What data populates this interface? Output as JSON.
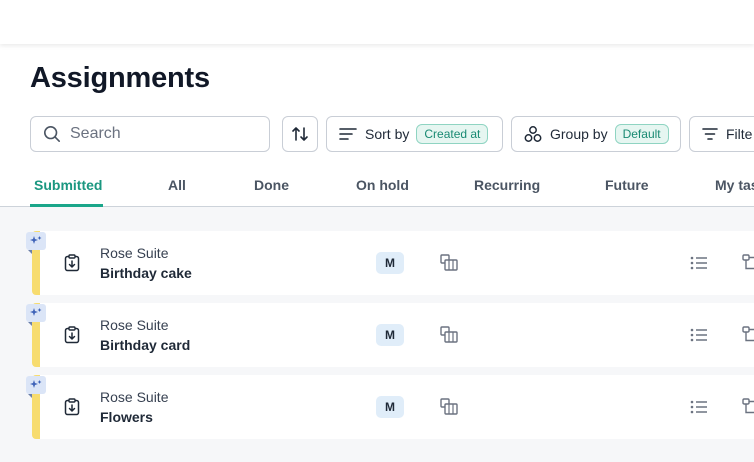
{
  "page": {
    "title": "Assignments"
  },
  "toolbar": {
    "search_placeholder": "Search",
    "sort_label": "Sort by",
    "sort_value": "Created at",
    "group_label": "Group by",
    "group_value": "Default",
    "filter_label": "Filte"
  },
  "tabs": [
    {
      "label": "Submitted",
      "active": true
    },
    {
      "label": "All"
    },
    {
      "label": "Done"
    },
    {
      "label": "On hold"
    },
    {
      "label": "Recurring"
    },
    {
      "label": "Future"
    },
    {
      "label": "My tas"
    }
  ],
  "tasks": [
    {
      "location": "Rose Suite",
      "name": "Birthday cake",
      "size": "M"
    },
    {
      "location": "Rose Suite",
      "name": "Birthday card",
      "size": "M"
    },
    {
      "location": "Rose Suite",
      "name": "Flowers",
      "size": "M"
    }
  ],
  "colors": {
    "accent": "#1aa68a",
    "card_stripe": "#f7dc6f",
    "size_badge_bg": "#e0edf9",
    "spark_badge_bg": "#dbe5f7"
  },
  "icons": {
    "search": "search-icon",
    "sort_direction": "sort-arrows-icon",
    "sort_by": "sort-lines-icon",
    "group_by": "group-circles-icon",
    "filter": "filter-icon",
    "spark": "sparkle-icon",
    "task": "clipboard-download-icon",
    "category": "category-icon",
    "checklist": "checklist-icon",
    "workflow": "workflow-icon"
  }
}
